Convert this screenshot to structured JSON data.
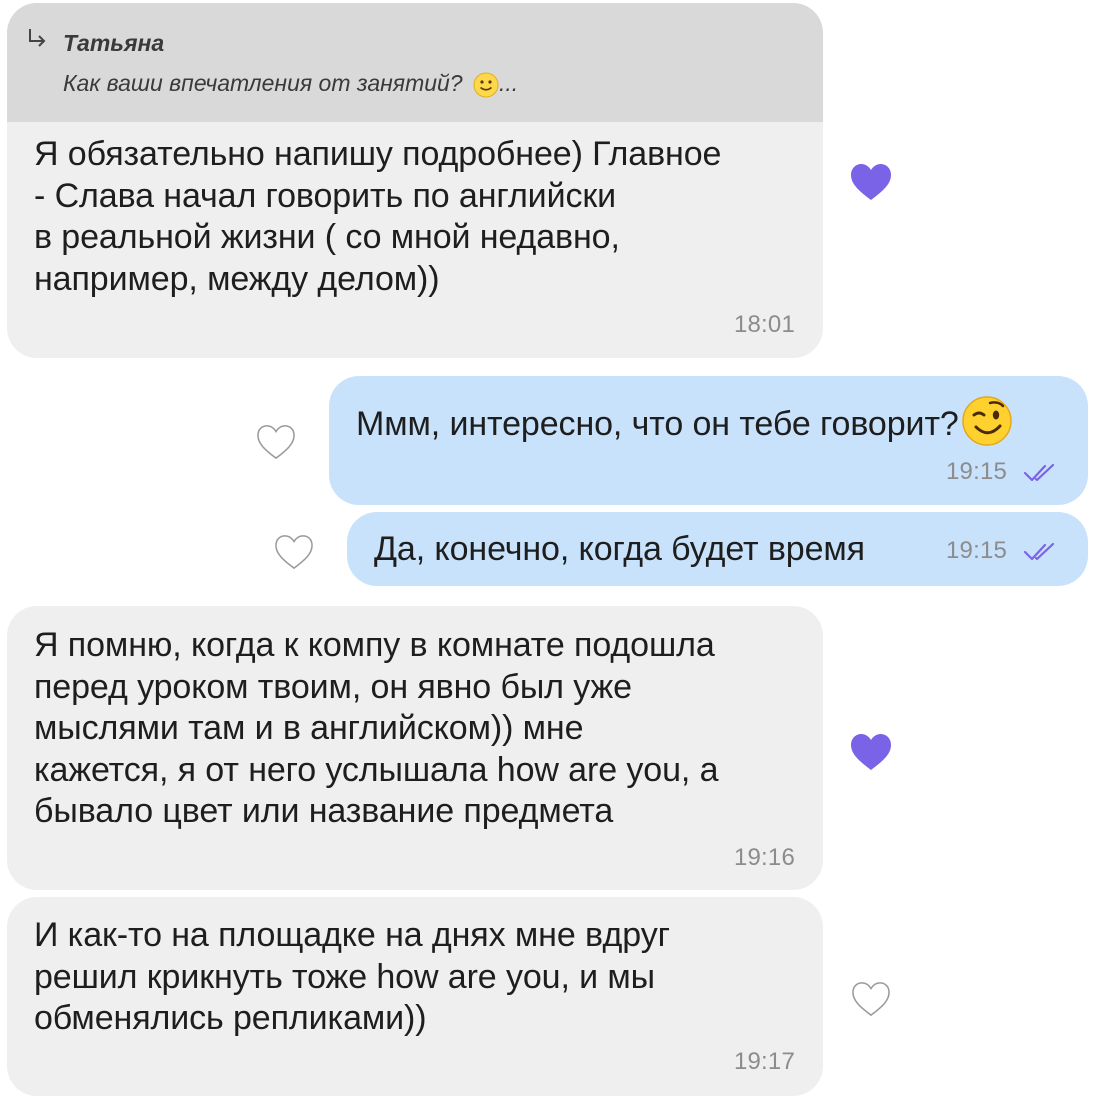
{
  "colors": {
    "incoming_bubble": "#efefef",
    "outgoing_bubble": "#c9e2fb",
    "reply_header": "#d9d9d9",
    "accent": "#7a63e6",
    "timestamp": "#8c8c8c"
  },
  "messages": [
    {
      "direction": "incoming",
      "reply": {
        "author": "Татьяна",
        "text": "Как ваши впечатления от занятий?",
        "suffix": "...",
        "emoji": "slightly-smiling-face"
      },
      "text": "Я обязательно напишу подробнее) Главное\n- Слава начал говорить по английски\nв реальной жизни ( со мной недавно,\nнапример, между делом))",
      "time": "18:01",
      "liked": true
    },
    {
      "direction": "outgoing",
      "text": "Ммм, интересно, что он тебе говорит?",
      "emoji": "winking-face",
      "time": "19:15",
      "read": true,
      "liked": false
    },
    {
      "direction": "outgoing",
      "text": "Да, конечно, когда будет время",
      "time": "19:15",
      "read": true,
      "liked": false
    },
    {
      "direction": "incoming",
      "text": "Я помню, когда к компу в комнате подошла\nперед уроком твоим, он явно был уже\nмыслями там и в английском)) мне\nкажется, я от него услышала how are you, а\nбывало цвет или название предмета",
      "time": "19:16",
      "liked": true
    },
    {
      "direction": "incoming",
      "text": "И как-то на площадке на днях мне вдруг\nрешил крикнуть тоже how are you, и мы\nобменялись репликами))",
      "time": "19:17",
      "liked": false
    }
  ]
}
